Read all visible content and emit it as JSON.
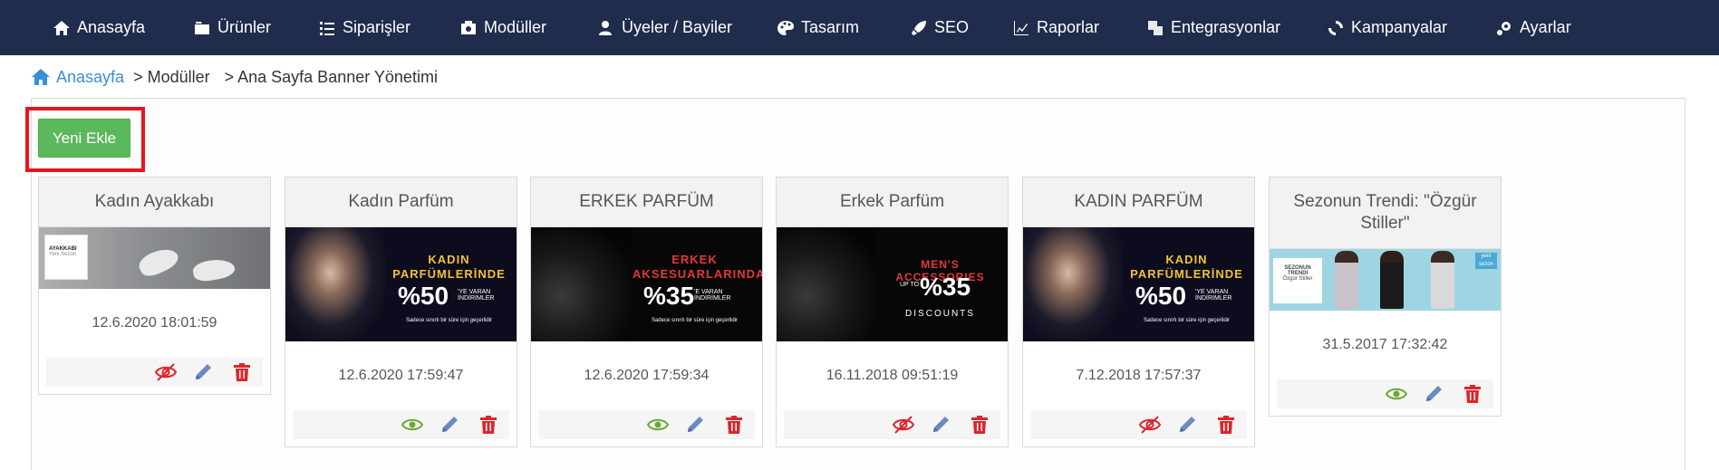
{
  "nav": {
    "items": [
      {
        "label": "Anasayfa",
        "icon": "home-icon"
      },
      {
        "label": "Ürünler",
        "icon": "products-icon"
      },
      {
        "label": "Siparişler",
        "icon": "list-icon"
      },
      {
        "label": "Modüller",
        "icon": "module-icon"
      },
      {
        "label": "Üyeler / Bayiler",
        "icon": "users-icon"
      },
      {
        "label": "Tasarım",
        "icon": "palette-icon"
      },
      {
        "label": "SEO",
        "icon": "rocket-icon"
      },
      {
        "label": "Raporlar",
        "icon": "chart-icon"
      },
      {
        "label": "Entegrasyonlar",
        "icon": "integration-icon"
      },
      {
        "label": "Kampanyalar",
        "icon": "campaign-icon"
      },
      {
        "label": "Ayarlar",
        "icon": "gear-icon"
      }
    ]
  },
  "breadcrumb": {
    "home": "Anasayfa",
    "level1": "> Modüller",
    "level2": "> Ana Sayfa Banner Yönetimi"
  },
  "toolbar": {
    "add_label": "Yeni Ekle"
  },
  "banners": [
    {
      "title": "Kadın Ayakkabı",
      "date": "12.6.2020 18:01:59",
      "visible": false,
      "image": {
        "label": "AYAKKABI",
        "sub": "Yeni Sezon"
      }
    },
    {
      "title": "Kadın Parfüm",
      "date": "12.6.2020 17:59:47",
      "visible": true,
      "image": {
        "line1": "KADIN",
        "line2": "PARFÜMLERİNDE",
        "big": "%50",
        "small": "'YE VARAN İNDİRİMLER",
        "foot": "Sadece sınırlı bir süre için geçerlidir"
      }
    },
    {
      "title": "ERKEK PARFÜM",
      "date": "12.6.2020 17:59:34",
      "visible": true,
      "image": {
        "line1": "ERKEK",
        "line2": "AKSESUARLARINDA",
        "big": "%35",
        "small": "'E VARAN İNDİRİMLER",
        "foot": "Sadece sınırlı bir süre için geçerlidir"
      }
    },
    {
      "title": "Erkek Parfüm",
      "date": "16.11.2018 09:51:19",
      "visible": false,
      "image": {
        "line1": "MEN'S ACCESSORIES",
        "line2": "UP TO",
        "big": "%35",
        "small": "DISCOUNTS"
      }
    },
    {
      "title": "KADIN PARFÜM",
      "date": "7.12.2018 17:57:37",
      "visible": false,
      "image": {
        "line1": "KADIN",
        "line2": "PARFÜMLERİNDE",
        "big": "%50",
        "small": "'YE VARAN İNDİRİMLER",
        "foot": "Sadece sınırlı bir süre için geçerlidir"
      }
    },
    {
      "title": "Sezonun Trendi: \"Özgür Stiller\"",
      "date": "31.5.2017 17:32:42",
      "visible": true,
      "image": {
        "label": "SEZONUN TRENDİ",
        "sub": "Özgür Stiller",
        "tag": "yeni sezon"
      }
    }
  ],
  "colors": {
    "nav_bg": "#1f2c4b",
    "link": "#3a8fd6",
    "add_button": "#5cb85c",
    "highlight": "#e8141b",
    "visible_icon": "#6aa936",
    "hidden_icon": "#e0242b",
    "edit_icon": "#6d89c4",
    "delete_icon": "#e0242b"
  }
}
